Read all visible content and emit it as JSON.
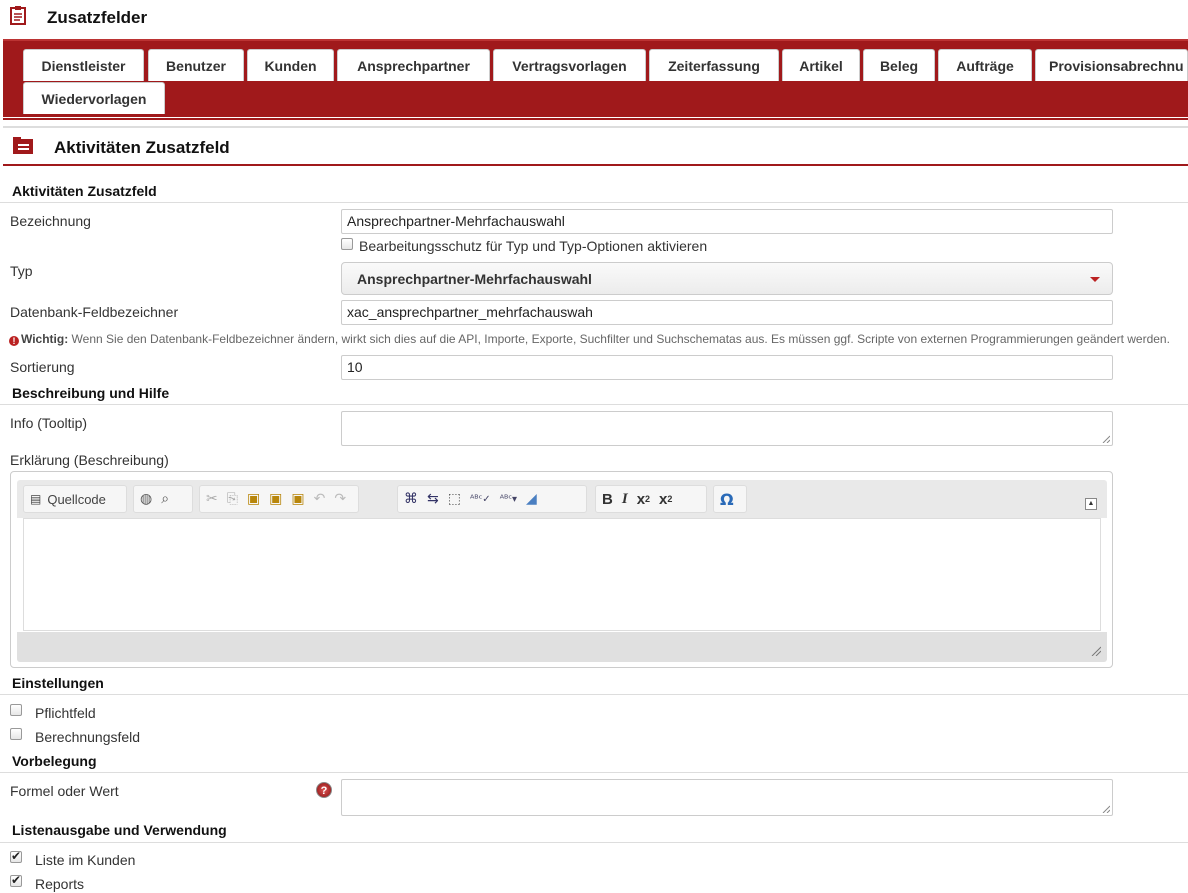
{
  "app": {
    "title": "Zusatzfelder",
    "icon": "clipboard-icon"
  },
  "tabs": [
    {
      "label": "Dienstleister"
    },
    {
      "label": "Benutzer"
    },
    {
      "label": "Kunden"
    },
    {
      "label": "Ansprechpartner"
    },
    {
      "label": "Vertragsvorlagen"
    },
    {
      "label": "Zeiterfassung"
    },
    {
      "label": "Artikel"
    },
    {
      "label": "Beleg"
    },
    {
      "label": "Aufträge"
    },
    {
      "label": "Provisionsabrechnu"
    },
    {
      "label": "Wiedervorlagen"
    }
  ],
  "panel": {
    "title": "Aktivitäten Zusatzfeld",
    "icon": "folder-list-icon"
  },
  "sections": {
    "main": "Aktivitäten Zusatzfeld",
    "help": "Beschreibung und Hilfe",
    "settings": "Einstellungen",
    "preset": "Vorbelegung",
    "list": "Listenausgabe und Verwendung"
  },
  "fields": {
    "bezeichnung": {
      "label": "Bezeichnung",
      "value": "Ansprechpartner-Mehrfachauswahl"
    },
    "protect": {
      "label": "Bearbeitungsschutz für Typ und Typ-Optionen aktivieren",
      "checked": false
    },
    "typ": {
      "label": "Typ",
      "value": "Ansprechpartner-Mehrfachauswahl"
    },
    "db": {
      "label": "Datenbank-Feldbezeichner",
      "value": "xac_ansprechpartner_mehrfachauswah"
    },
    "warning": {
      "strong": "Wichtig:",
      "text": " Wenn Sie den Datenbank-Feldbezeichner ändern, wirkt sich dies auf die API, Importe, Exporte, Suchfilter und Suchschematas aus. Es müssen ggf. Scripte von externen Programmierungen geändert werden."
    },
    "sortierung": {
      "label": "Sortierung",
      "value": "10"
    },
    "info": {
      "label": "Info (Tooltip)",
      "value": ""
    },
    "erklaerung": {
      "label": "Erklärung (Beschreibung)"
    },
    "pflichtfeld": {
      "label": "Pflichtfeld",
      "checked": false
    },
    "berechnung": {
      "label": "Berechnungsfeld",
      "checked": false
    },
    "formel": {
      "label": "Formel oder Wert",
      "value": ""
    },
    "liste_kunden": {
      "label": "Liste im Kunden",
      "checked": true
    },
    "reports": {
      "label": "Reports",
      "checked": true
    }
  },
  "editor": {
    "source_label": "Quellcode"
  },
  "colors": {
    "brand": "#a0191b"
  }
}
